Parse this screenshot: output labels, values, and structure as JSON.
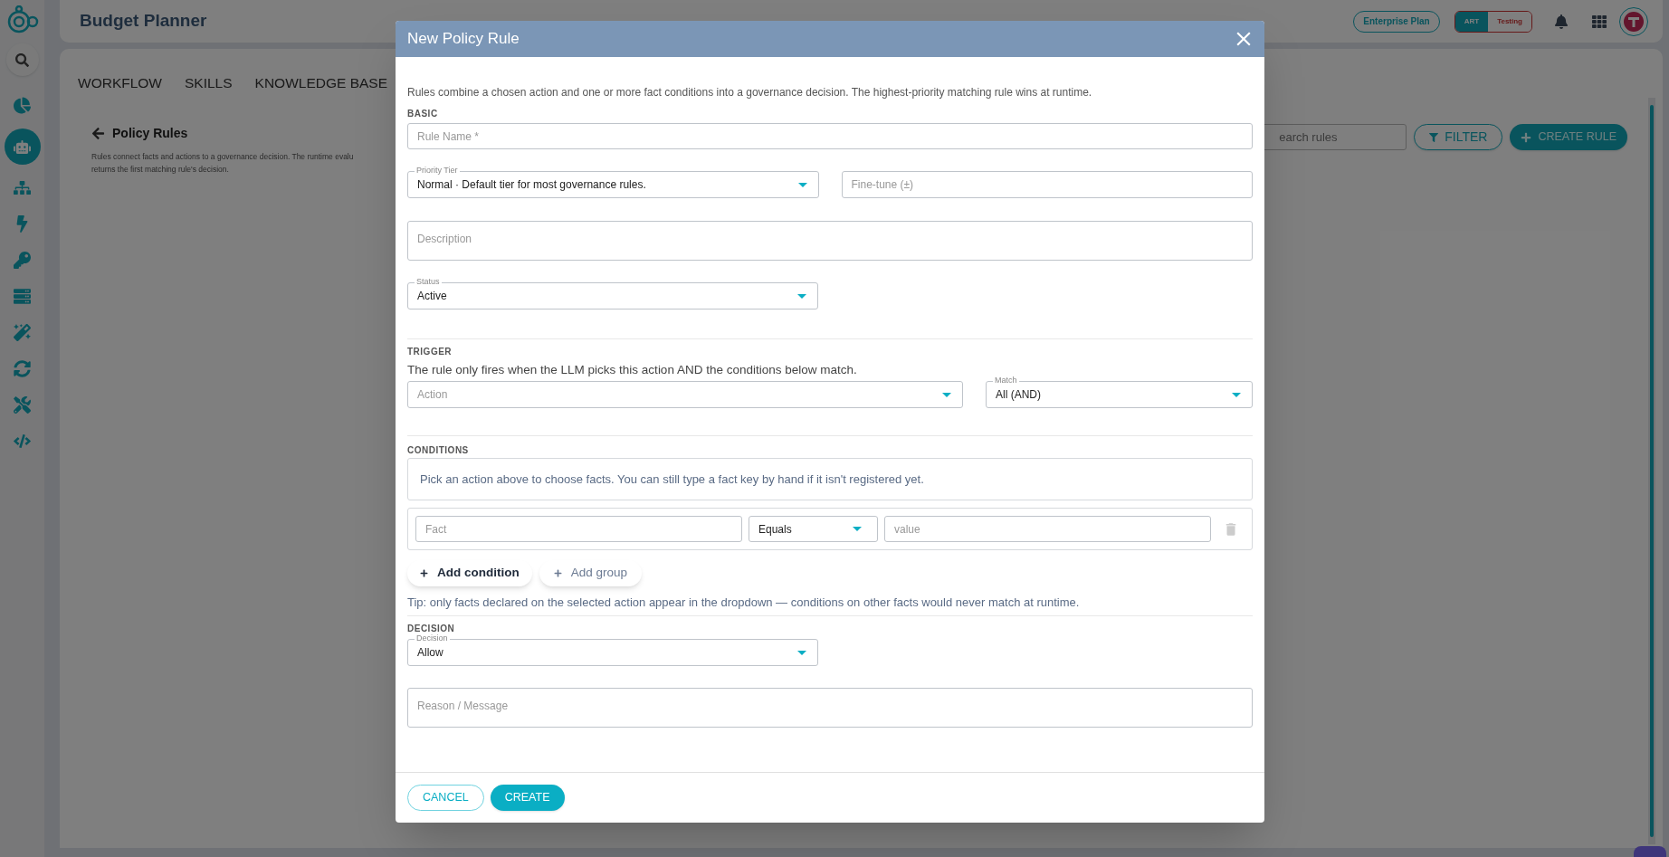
{
  "app": {
    "title": "Budget Planner",
    "plan": "Enterprise Plan",
    "env_toggle": [
      {
        "label": "ART",
        "selected": true
      },
      {
        "label": "Testing",
        "selected": false
      }
    ]
  },
  "sidebar": {
    "items": [
      {
        "selected": false
      },
      {
        "selected": true
      },
      {
        "selected": false
      },
      {
        "selected": false
      },
      {
        "selected": false
      },
      {
        "selected": false
      },
      {
        "selected": false
      },
      {
        "selected": false
      },
      {
        "selected": false
      },
      {
        "selected": false
      }
    ]
  },
  "nav_tabs": [
    {
      "label": "WORKFLOW"
    },
    {
      "label": "SKILLS"
    },
    {
      "label": "KNOWLEDGE BASE"
    }
  ],
  "page": {
    "title": "Policy Rules",
    "description_lines": [
      "Rules connect facts and actions to a governance decision. The runtime evalu",
      "returns the first matching rule's decision."
    ],
    "search": {
      "placeholder": "earch rules"
    },
    "filter_button": "FILTER",
    "create_button": "CREATE RULE"
  },
  "dialog": {
    "title": "New Policy Rule",
    "intro": "Rules combine a chosen action and one or more fact conditions into a governance decision. The highest-priority matching rule wins at runtime.",
    "basic": {
      "heading": "BASIC",
      "rule_name": {
        "placeholder": "Rule Name *"
      },
      "priority_tier": {
        "label": "Priority Tier",
        "value": "Normal · Default tier for most governance rules."
      },
      "fine_tune": {
        "placeholder": "Fine-tune (±)"
      },
      "description": {
        "placeholder": "Description"
      },
      "status": {
        "label": "Status",
        "value": "Active"
      }
    },
    "trigger": {
      "heading": "TRIGGER",
      "hint": "The rule only fires when the LLM picks this action AND the conditions below match.",
      "action": {
        "placeholder": "Action"
      },
      "match": {
        "label": "Match",
        "value": "All (AND)"
      }
    },
    "conditions": {
      "heading": "CONDITIONS",
      "info": "Pick an action above to choose facts. You can still type a fact key by hand if it isn't registered yet.",
      "rows": [
        {
          "fact": {
            "placeholder": "Fact"
          },
          "operator": {
            "value": "Equals"
          },
          "value": {
            "placeholder": "value"
          },
          "delete_disabled": true
        }
      ],
      "add_condition": "Add condition",
      "add_group": "Add group",
      "tip": "Tip: only facts declared on the selected action appear in the dropdown — conditions on other facts would never match at runtime."
    },
    "decision": {
      "heading": "DECISION",
      "decision": {
        "label": "Decision",
        "value": "Allow"
      },
      "reason": {
        "placeholder": "Reason / Message"
      }
    },
    "buttons": {
      "cancel": "CANCEL",
      "create": "CREATE"
    }
  }
}
